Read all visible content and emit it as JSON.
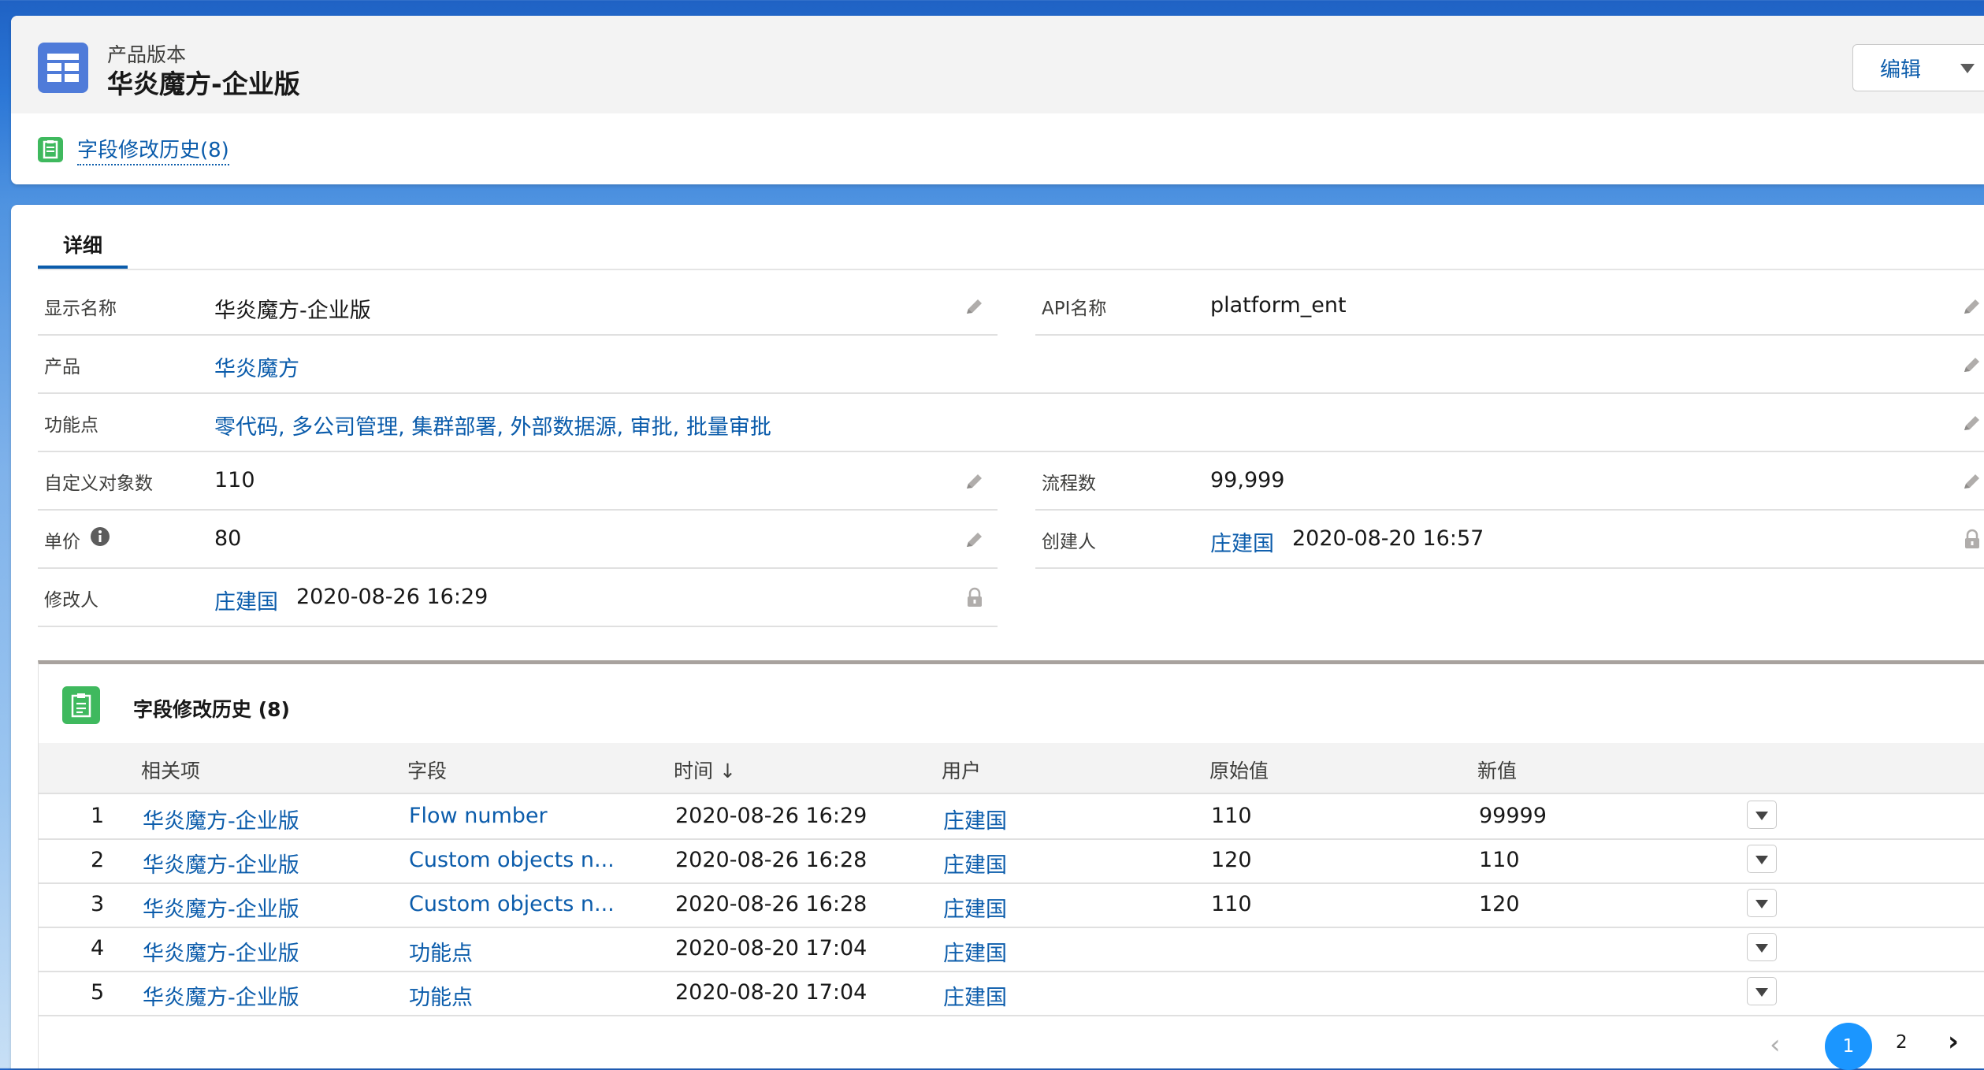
{
  "header": {
    "object_type": "产品版本",
    "record_title": "华炎魔方-企业版",
    "edit_label": "编辑",
    "related_link": "字段修改历史(8)"
  },
  "tabs": [
    {
      "label": "详细"
    }
  ],
  "fields": {
    "display_name": {
      "label": "显示名称",
      "value": "华炎魔方-企业版"
    },
    "api_name": {
      "label": "API名称",
      "value": "platform_ent"
    },
    "product": {
      "label": "产品",
      "value": "华炎魔方"
    },
    "features": {
      "label": "功能点",
      "value": "零代码, 多公司管理, 集群部署, 外部数据源, 审批, 批量审批"
    },
    "custom_objects": {
      "label": "自定义对象数",
      "value": "110"
    },
    "flow_count": {
      "label": "流程数",
      "value": "99,999"
    },
    "unit_price": {
      "label": "单价",
      "value": "80"
    },
    "created_by": {
      "label": "创建人",
      "user": "庄建国",
      "time": "2020-08-20 16:57"
    },
    "modified_by": {
      "label": "修改人",
      "user": "庄建国",
      "time": "2020-08-26 16:29"
    }
  },
  "related_list": {
    "title": "字段修改历史 (8)",
    "columns": [
      "相关项",
      "字段",
      "时间 ↓",
      "用户",
      "原始值",
      "新值"
    ],
    "rows": [
      {
        "num": "1",
        "related": "华炎魔方-企业版",
        "field": "Flow number",
        "time": "2020-08-26 16:29",
        "user": "庄建国",
        "old": "110",
        "new": "99999"
      },
      {
        "num": "2",
        "related": "华炎魔方-企业版",
        "field": "Custom objects n...",
        "time": "2020-08-26 16:28",
        "user": "庄建国",
        "old": "120",
        "new": "110"
      },
      {
        "num": "3",
        "related": "华炎魔方-企业版",
        "field": "Custom objects n...",
        "time": "2020-08-26 16:28",
        "user": "庄建国",
        "old": "110",
        "new": "120"
      },
      {
        "num": "4",
        "related": "华炎魔方-企业版",
        "field": "功能点",
        "time": "2020-08-20 17:04",
        "user": "庄建国",
        "old": "",
        "new": ""
      },
      {
        "num": "5",
        "related": "华炎魔方-企业版",
        "field": "功能点",
        "time": "2020-08-20 17:04",
        "user": "庄建国",
        "old": "",
        "new": ""
      }
    ]
  },
  "pagination": {
    "prev": "‹",
    "pages": [
      "1",
      "2"
    ],
    "next": "›",
    "current": "1"
  },
  "colors": {
    "link": "#0b5cab",
    "brand": "#1b96ff",
    "object_icon": "#4f7bd9",
    "history_icon": "#3fb95e"
  },
  "icons": {
    "object": "table-icon",
    "history": "clipboard-icon",
    "edit": "pencil-icon",
    "locked": "lock-icon",
    "info": "info-icon"
  }
}
